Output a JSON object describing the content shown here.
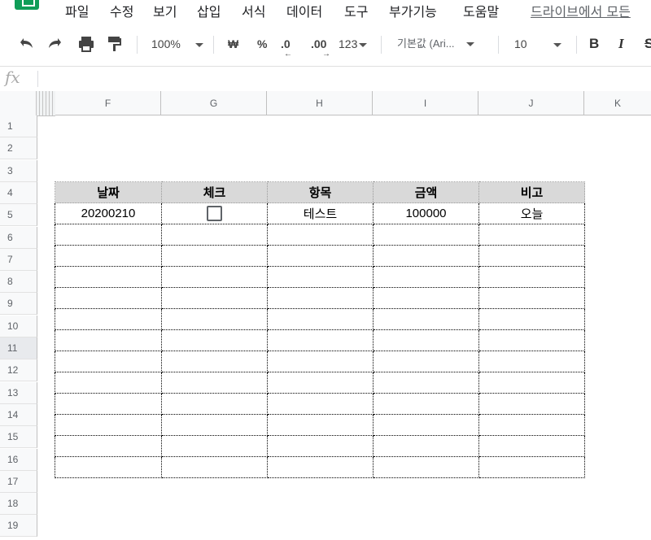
{
  "menu": {
    "items": [
      "파일",
      "수정",
      "보기",
      "삽입",
      "서식",
      "데이터",
      "도구",
      "부가기능",
      "도움말"
    ],
    "link": "드라이브에서 모든"
  },
  "toolbar": {
    "zoom": "100%",
    "currency": "₩",
    "percent": "%",
    "dec_decrease": ".0",
    "dec_increase": ".00",
    "number_format": "123",
    "font": "기본값 (Ari...",
    "font_size": "10",
    "bold": "B",
    "italic": "I",
    "strike": "S"
  },
  "formula_bar": {
    "fx": "fx",
    "value": ""
  },
  "columns": [
    "F",
    "G",
    "H",
    "I",
    "J",
    "K"
  ],
  "rows": [
    "1",
    "2",
    "3",
    "4",
    "5",
    "6",
    "7",
    "8",
    "9",
    "10",
    "11",
    "12",
    "13",
    "14",
    "15",
    "16",
    "17",
    "18",
    "19"
  ],
  "selected_row": "11",
  "table": {
    "headers": [
      "날짜",
      "체크",
      "항목",
      "금액",
      "비고"
    ],
    "row1": {
      "date": "20200210",
      "checked": false,
      "item": "테스트",
      "amount": "100000",
      "note": "오늘"
    },
    "empty_rows": 12
  }
}
